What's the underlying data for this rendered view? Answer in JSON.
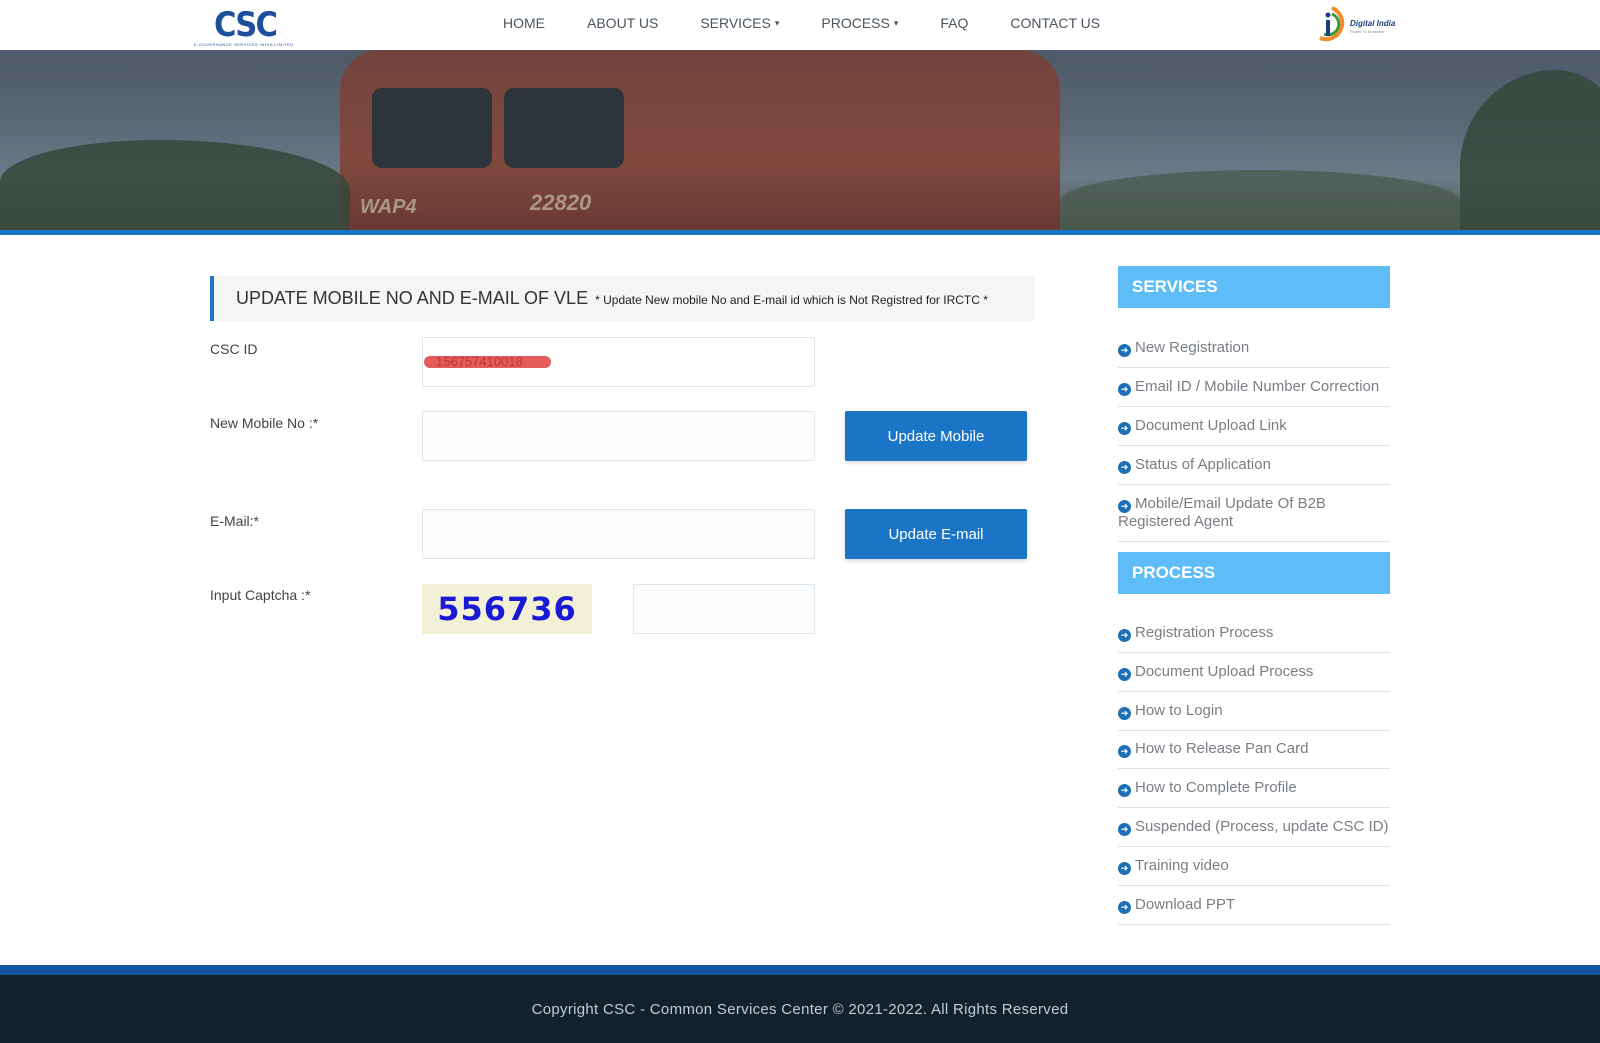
{
  "header": {
    "logo_text": "CSC",
    "logo_sub": "E-GOVERNANCE SERVICES INDIA LIMITED",
    "nav": [
      {
        "label": "HOME"
      },
      {
        "label": "ABOUT US"
      },
      {
        "label": "SERVICES",
        "caret": "▾"
      },
      {
        "label": "PROCESS",
        "caret": "▾"
      },
      {
        "label": "FAQ"
      },
      {
        "label": "CONTACT US"
      }
    ],
    "di_logo_text": "Digital India",
    "di_logo_sub": "Power To Empower"
  },
  "banner": {
    "loco_model": "WAP4",
    "loco_number": "22820"
  },
  "form": {
    "title": "UPDATE MOBILE NO AND E-MAIL OF VLE",
    "note": "* Update New mobile No and E-mail id which is Not Registred for IRCTC *",
    "csc_id_label": "CSC ID",
    "csc_id_value": "156757410018",
    "mobile_label": "New Mobile No :*",
    "mobile_value": "",
    "update_mobile_button": "Update Mobile",
    "email_label": "E-Mail:*",
    "email_value": "",
    "update_email_button": "Update E-mail",
    "captcha_label": "Input Captcha :*",
    "captcha_code": "556736",
    "captcha_value": ""
  },
  "sidebar": {
    "services_title": "SERVICES",
    "services": [
      "New Registration",
      "Email ID / Mobile Number Correction",
      "Document Upload Link",
      "Status of Application",
      "Mobile/Email Update Of B2B Registered Agent"
    ],
    "process_title": "PROCESS",
    "process": [
      "Registration Process",
      "Document Upload Process",
      "How to Login",
      "How to Release Pan Card",
      "How to Complete Profile",
      "Suspended (Process, update CSC ID)",
      "Training video",
      "Download PPT"
    ]
  },
  "footer": {
    "copyright": "Copyright CSC - Common Services Center © 2021-2022. All Rights Reserved"
  },
  "colors": {
    "primary": "#1a75c7",
    "sidebar_header": "#5ebdf7",
    "footer_bg": "#13202e"
  }
}
